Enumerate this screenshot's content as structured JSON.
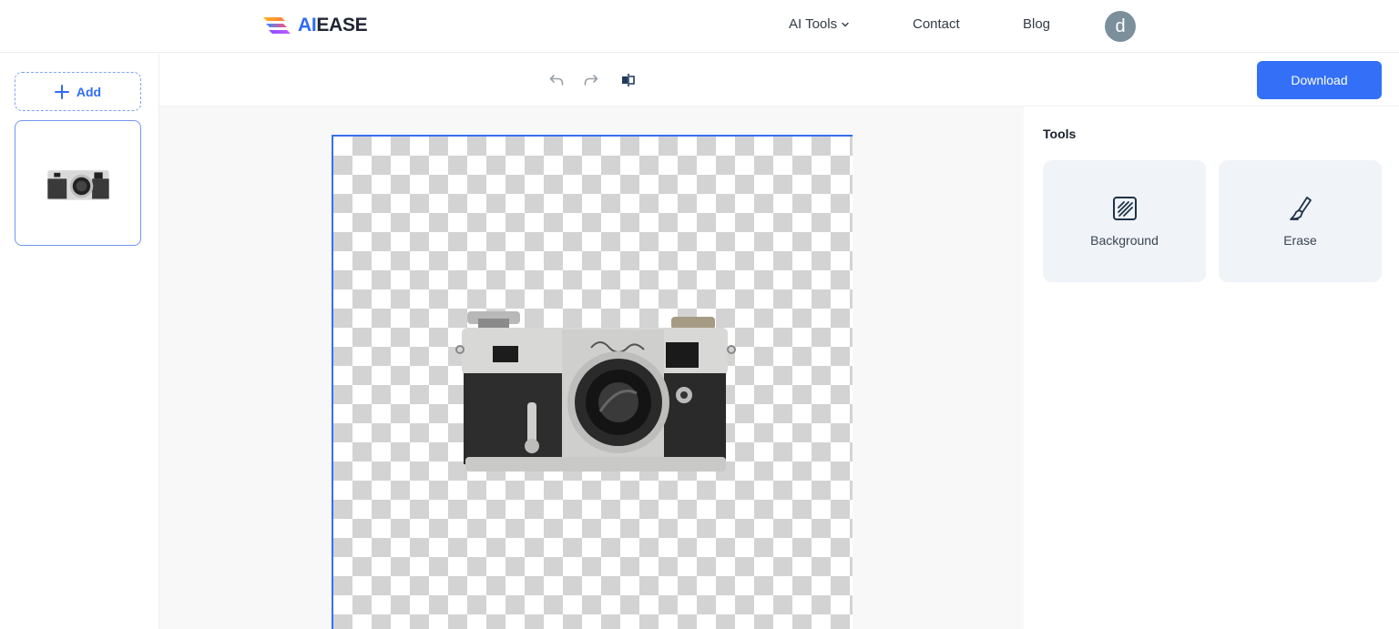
{
  "header": {
    "logo": {
      "part1": "AI",
      "part2": "EASE"
    },
    "nav": [
      {
        "label": "AI Tools",
        "has_dropdown": true
      },
      {
        "label": "Contact"
      },
      {
        "label": "Blog"
      }
    ],
    "avatar_initial": "d"
  },
  "sidebar": {
    "add_label": "Add",
    "add_icon": "plus-icon",
    "thumbnails": [
      {
        "subject": "vintage camera",
        "selected": true
      }
    ]
  },
  "toolbar": {
    "icons": [
      "undo-icon",
      "redo-icon",
      "compare-icon"
    ],
    "download_label": "Download"
  },
  "canvas": {
    "subject": "vintage rangefinder camera (background removed)",
    "background": "transparent-checkerboard"
  },
  "tools_panel": {
    "title": "Tools",
    "tools": [
      {
        "label": "Background",
        "icon": "background-pattern-icon"
      },
      {
        "label": "Erase",
        "icon": "brush-icon"
      }
    ]
  },
  "colors": {
    "accent": "#3370f7",
    "tool_card_bg": "#f0f3f8",
    "workspace_bg": "#f8f8f8",
    "avatar_bg": "#7b8f9c"
  }
}
